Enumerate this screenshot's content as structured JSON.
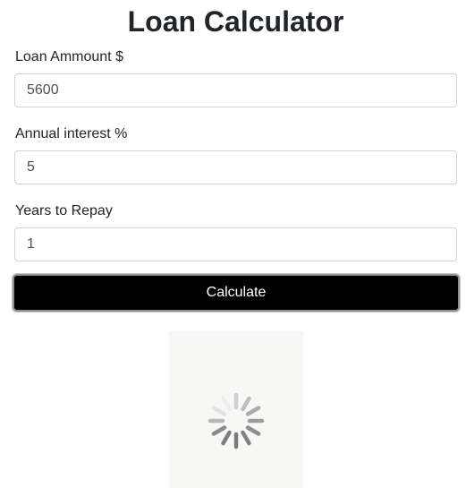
{
  "header": {
    "title": "Loan Calculator"
  },
  "form": {
    "amount_label": "Loan Ammount $",
    "amount_value": "5600",
    "interest_label": "Annual interest %",
    "interest_value": "5",
    "years_label": "Years to Repay",
    "years_value": "1",
    "submit_label": "Calculate"
  },
  "loader": {
    "icon": "loading-spinner-icon"
  },
  "colors": {
    "button_background": "#000000",
    "button_text": "#ffffff",
    "loader_panel": "#f7f8f6",
    "spinner": "#8a8a8a"
  }
}
